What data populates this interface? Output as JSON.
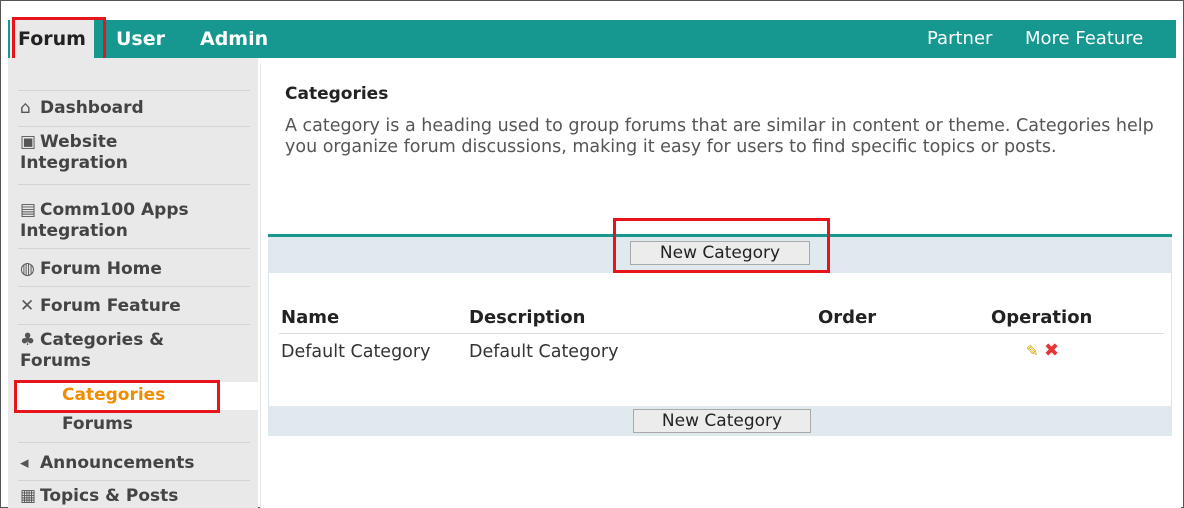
{
  "topnav": {
    "tabs": [
      {
        "label": "Forum",
        "active": true
      },
      {
        "label": "User",
        "active": false
      },
      {
        "label": "Admin",
        "active": false
      }
    ],
    "right_links": [
      "Partner",
      "More Feature"
    ]
  },
  "sidebar": {
    "items": [
      {
        "label": "Dashboard",
        "icon": "home-icon"
      },
      {
        "label": "Website",
        "label2": "Integration",
        "icon": "website-icon"
      },
      {
        "label": "Comm100 Apps",
        "label2": "Integration",
        "icon": "apps-icon"
      },
      {
        "label": "Forum Home",
        "icon": "globe-icon"
      },
      {
        "label": "Forum Feature",
        "icon": "tools-icon"
      },
      {
        "label": "Categories &",
        "label2": "Forums",
        "icon": "sitemap-icon"
      },
      {
        "label": "Announcements",
        "icon": "speaker-icon"
      },
      {
        "label": "Topics & Posts",
        "icon": "posts-icon"
      }
    ],
    "subitems": [
      {
        "label": "Categories",
        "active": true
      },
      {
        "label": "Forums",
        "active": false
      }
    ]
  },
  "main": {
    "title": "Categories",
    "description": "A category is a heading used to group forums that are similar in content or theme. Categories help you organize forum discussions, making it easy for users to find specific topics or posts.",
    "new_button_label": "New Category",
    "columns": [
      "Name",
      "Description",
      "Order",
      "Operation"
    ],
    "rows": [
      {
        "name": "Default Category",
        "description": "Default Category",
        "order": "",
        "operations": [
          "edit-icon",
          "delete-icon"
        ]
      }
    ]
  },
  "colors": {
    "nav_teal": "#16978f",
    "sidebar_bg": "#e9e9e9",
    "active_orange": "#f08c00",
    "highlight_red": "#e8141b",
    "bar_bg": "#dfe9ee"
  }
}
